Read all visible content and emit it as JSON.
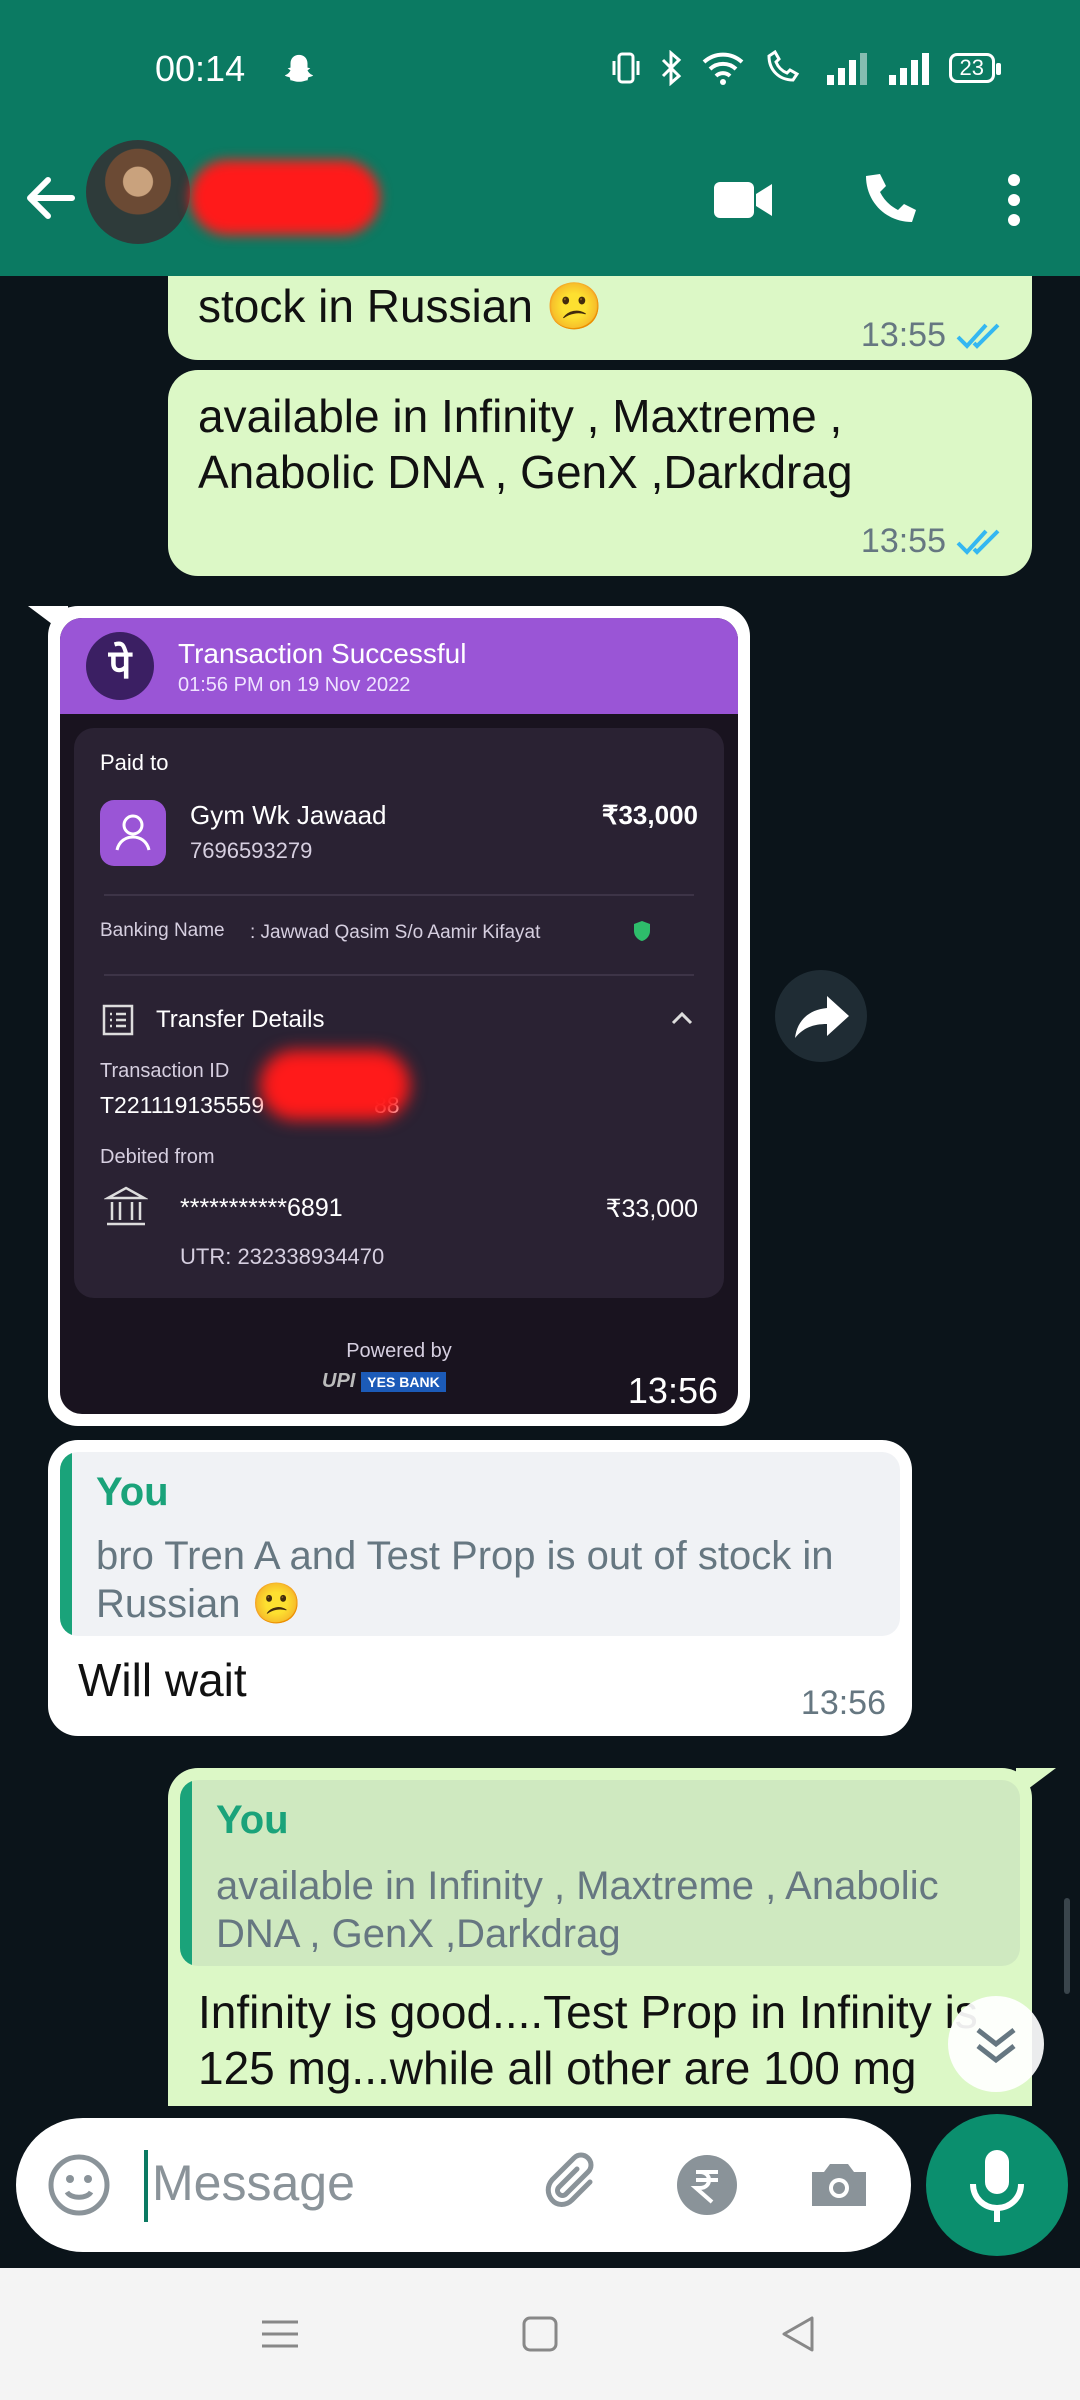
{
  "status_bar": {
    "time": "00:14",
    "battery": "23"
  },
  "header": {
    "contact_name": ""
  },
  "messages": {
    "m1": {
      "text": "stock in Russian 😕",
      "time": "13:55"
    },
    "m2": {
      "text": "available in Infinity , Maxtreme , Anabolic DNA , GenX ,Darkdrag",
      "time": "13:55"
    },
    "payment": {
      "title": "Transaction Successful",
      "date": "01:56 PM on 19 Nov 2022",
      "paid_to_label": "Paid to",
      "payee_name": "Gym Wk Jawaad",
      "payee_phone": "7696593279",
      "amount": "₹33,000",
      "banking_name_label": "Banking Name",
      "banking_name_value": ":  Jawwad Qasim S/o Aamir Kifayat",
      "transfer_details_label": "Transfer Details",
      "transaction_id_label": "Transaction ID",
      "transaction_id_start": "T221119135559",
      "transaction_id_end": "88",
      "debited_from_label": "Debited from",
      "account_masked": "***********6891",
      "debited_amount": "₹33,000",
      "utr": "UTR: 232338934470",
      "powered_by": "Powered by",
      "upi_label": "UPI",
      "bank_label": "YES BANK",
      "time": "13:56"
    },
    "m4": {
      "quote_author": "You",
      "quote_text": "bro Tren A and Test Prop is out of stock in Russian 😕",
      "text": "Will wait",
      "time": "13:56"
    },
    "m5": {
      "quote_author": "You",
      "quote_text": "available in Infinity , Maxtreme , Anabolic DNA , GenX ,Darkdrag",
      "text": "Infinity is good....Test Prop in Infinity is 125 mg...while all other are 100 mg"
    }
  },
  "input": {
    "placeholder": "Message"
  },
  "colors": {
    "header_green": "#0b7a62",
    "outgoing_bubble": "#dcf8c6",
    "tick_blue": "#34b7f1",
    "chat_bg": "#0b141a"
  }
}
